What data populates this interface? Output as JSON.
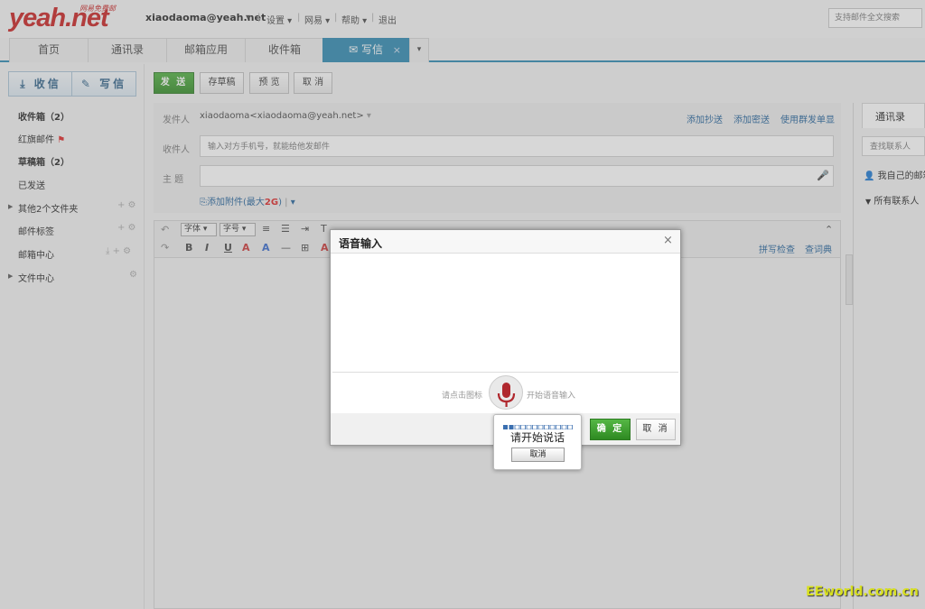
{
  "header": {
    "logo": "yeah.net",
    "logo_sub": "网易免费邮",
    "user_email": "xiaodaoma@yeah.net",
    "nav": [
      "设置",
      "网易",
      "帮助",
      "退出"
    ],
    "search_placeholder": "支持邮件全文搜索"
  },
  "tabs": [
    {
      "label": "首页"
    },
    {
      "label": "通讯录"
    },
    {
      "label": "邮箱应用"
    },
    {
      "label": "收件箱"
    },
    {
      "label": "写信"
    }
  ],
  "sidebar": {
    "receive_label": "收信",
    "compose_label": "写信",
    "items": [
      "收件箱（2）",
      "红旗邮件",
      "草稿箱（2）",
      "已发送",
      "其他2个文件夹",
      "邮件标签",
      "邮箱中心",
      "文件中心"
    ]
  },
  "toolbar": {
    "send": "发 送",
    "save_draft": "存草稿",
    "preview": "预 览",
    "cancel": "取 消"
  },
  "compose": {
    "from_label": "发件人",
    "from_value": "xiaodaoma<xiaodaoma@yeah.net>",
    "add_cc": "添加抄送",
    "add_bcc": "添加密送",
    "group_send": "使用群发单显",
    "to_label": "收件人",
    "to_placeholder": "输入对方手机号，就能给他发邮件",
    "subject_label": "主  题",
    "attach_prefix": "添加附件(最大",
    "attach_size": "2G",
    "attach_suffix": ")"
  },
  "editor": {
    "font_select": "字体",
    "size_select": "字号",
    "spell_check": "拼写检查",
    "dictionary": "查词典"
  },
  "right_panel": {
    "tab": "通讯录",
    "search_placeholder": "查找联系人",
    "my_mailbox": "我自己的邮箱",
    "all_contacts": "所有联系人（"
  },
  "dialog": {
    "title": "语音输入",
    "hint_left": "请点击图标",
    "hint_right": "开始语音输入",
    "ok": "确 定",
    "cancel": "取 消"
  },
  "popup": {
    "text": "请开始说话",
    "cancel": "取消"
  },
  "watermark": "EEworld.com.cn"
}
